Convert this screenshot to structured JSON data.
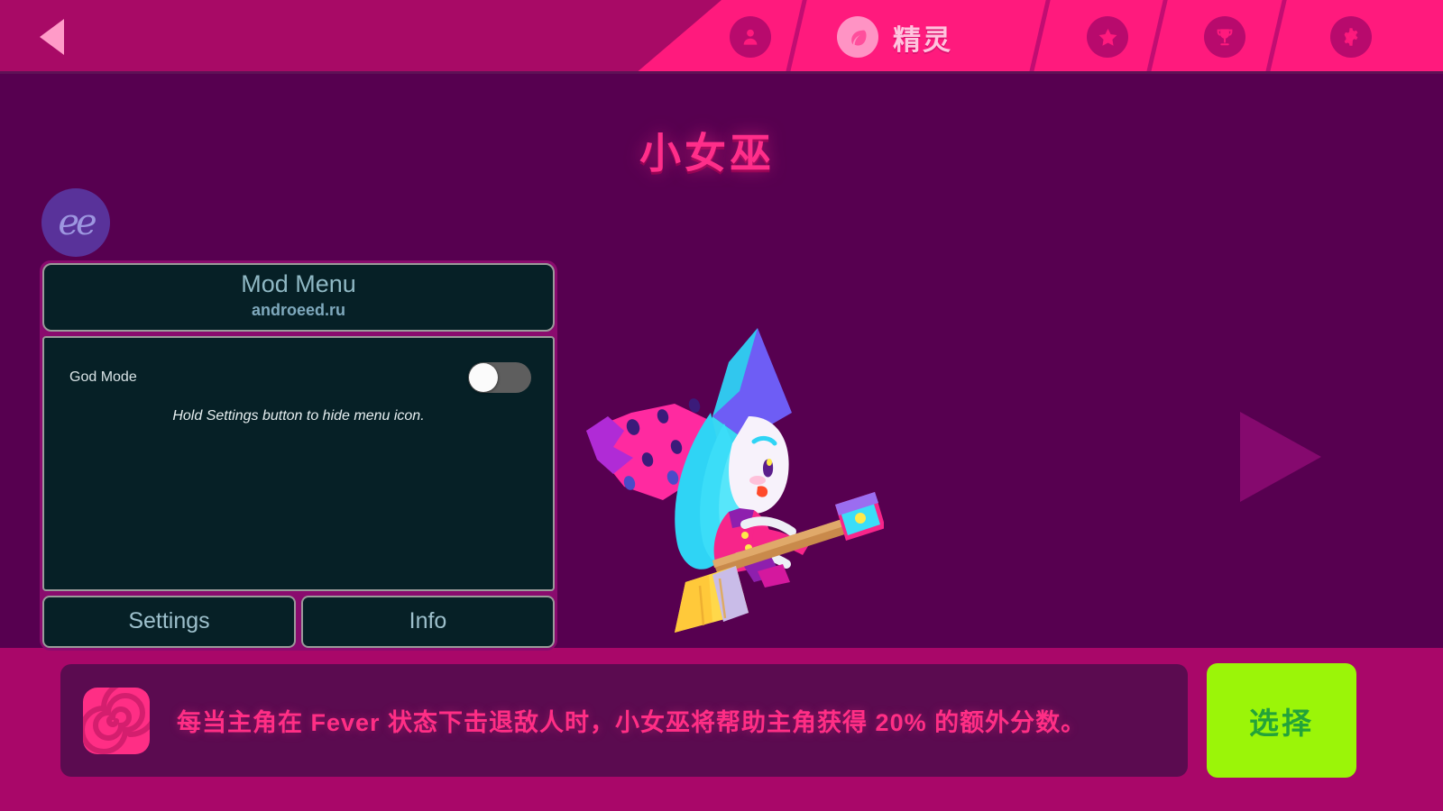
{
  "topbar": {
    "back_icon": "back-triangle-icon",
    "tabs": [
      {
        "id": "profile",
        "icon": "person-icon",
        "label": ""
      },
      {
        "id": "spirit",
        "icon": "leaf-icon",
        "label": "精灵",
        "active": true
      },
      {
        "id": "star",
        "icon": "star-icon",
        "label": ""
      },
      {
        "id": "trophy",
        "icon": "trophy-icon",
        "label": ""
      },
      {
        "id": "settings",
        "icon": "gear-icon",
        "label": ""
      }
    ]
  },
  "stage": {
    "character_title": "小女巫",
    "badge_text": "ee",
    "next_arrow_icon": "next-triangle-icon",
    "character_art_name": "little-witch-on-broom"
  },
  "mod_menu": {
    "title": "Mod Menu",
    "subtitle": "androeed.ru",
    "god_mode_label": "God Mode",
    "god_mode_on": false,
    "hint": "Hold Settings button to hide menu icon.",
    "settings_button": "Settings",
    "info_button": "Info"
  },
  "bottom": {
    "ability_icon": "spiral-icon",
    "description": "每当主角在 Fever 状态下击退敌人时，小女巫将帮助主角获得 20% 的额外分数。",
    "select_button": "选择"
  },
  "colors": {
    "pink": "#FF1A7D",
    "pink_dark": "#A80A66",
    "stage_bg": "#570050",
    "bottom_bg": "#A90769",
    "panel_bg": "#062026",
    "panel_frame": "#8A0B6E",
    "accent_text": "#FF2E85",
    "select_green": "#9BF508",
    "select_green_text": "#23A33A"
  }
}
